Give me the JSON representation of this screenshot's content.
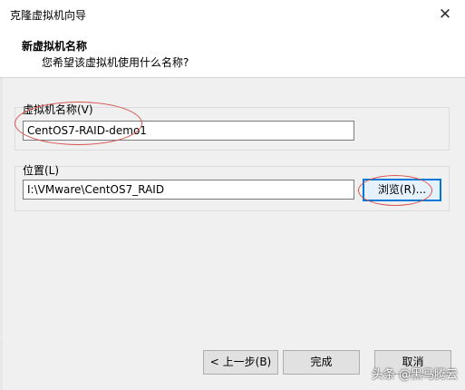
{
  "window": {
    "title": "克隆虚拟机向导",
    "close_glyph": "✕"
  },
  "header": {
    "title": "新虚拟机名称",
    "subtitle": "您希望该虚拟机使用什么名称?"
  },
  "name_group": {
    "label": "虚拟机名称(V)",
    "value": "CentOS7-RAID-demo1"
  },
  "location_group": {
    "label": "位置(L)",
    "value": "I:\\VMware\\CentOS7_RAID",
    "browse_label": "浏览(R)..."
  },
  "footer": {
    "back_label": "< 上一步(B)",
    "finish_label": "完成",
    "cancel_label": "取消"
  },
  "watermark": {
    "text": "头条 @黑马腾云"
  },
  "colors": {
    "annotation": "#d9534f",
    "focus_border": "#0078d7"
  }
}
